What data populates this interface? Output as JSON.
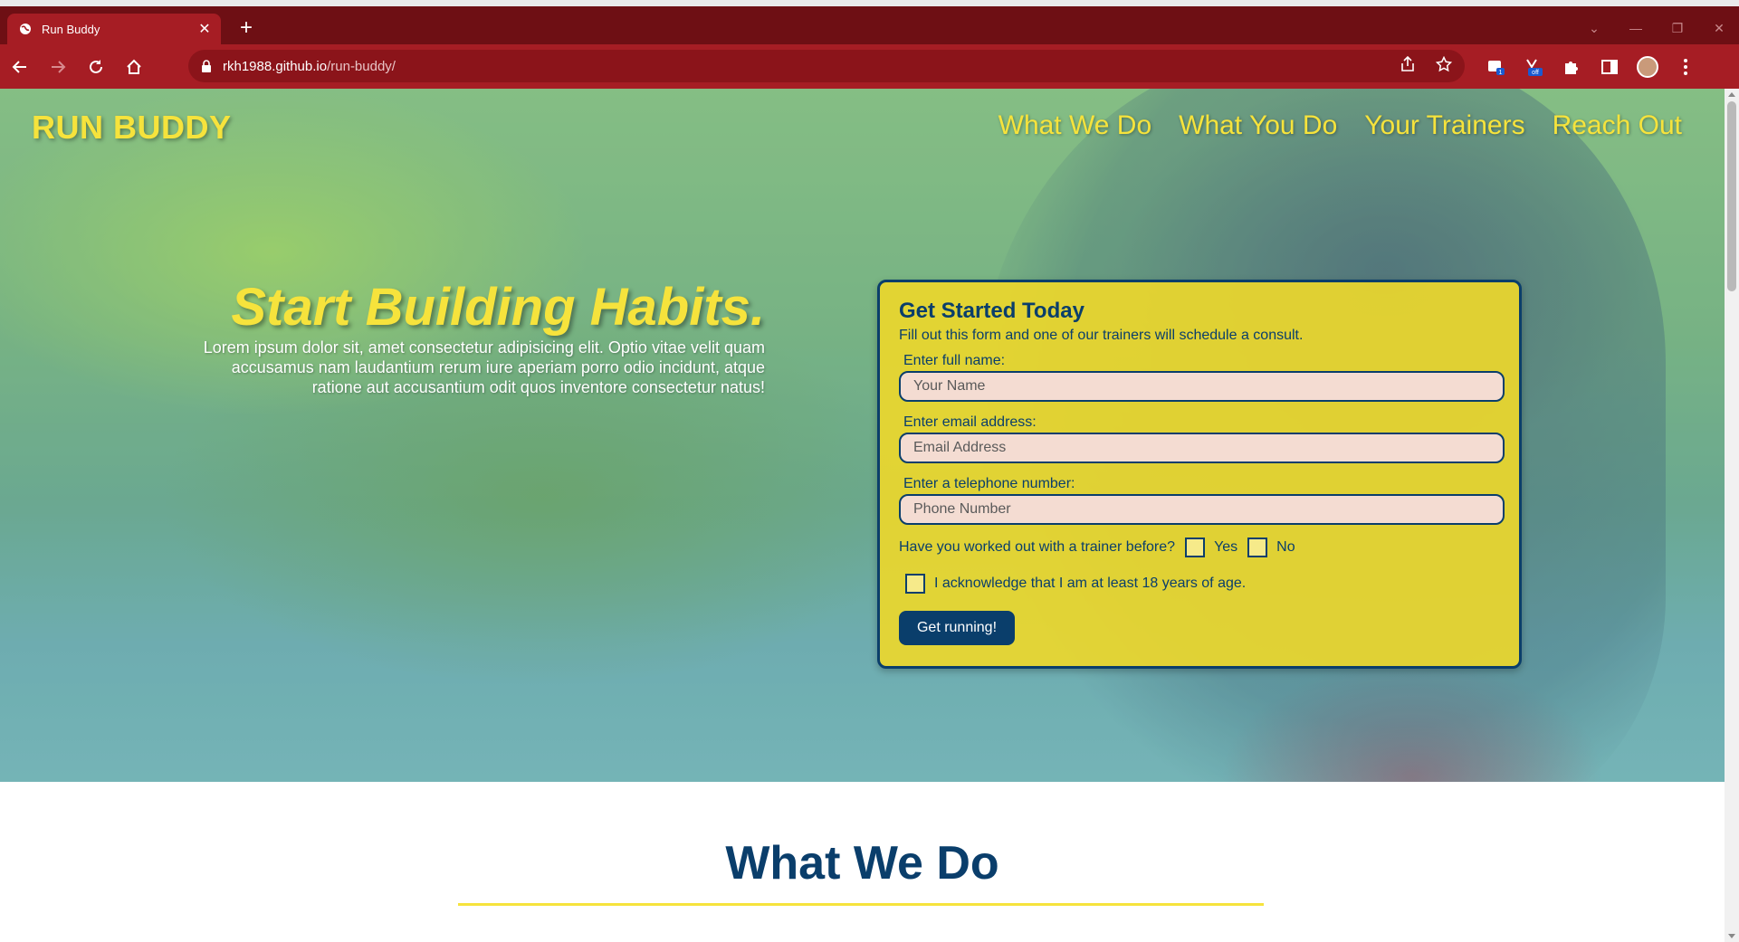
{
  "browser": {
    "tab_title": "Run Buddy",
    "tab_close_glyph": "✕",
    "new_tab_glyph": "+",
    "url_host": "rkh1988.github.io",
    "url_path": "/run-buddy/",
    "icons": [
      "back-icon",
      "forward-icon",
      "reload-icon",
      "home-icon",
      "lock-icon",
      "share-icon",
      "star-icon",
      "extension-icon",
      "puzzle-icon",
      "sidepanel-icon",
      "profile-avatar",
      "menu-icon"
    ],
    "extension_badges": {
      "first": "1",
      "second": "off"
    }
  },
  "site": {
    "brand": "RUN BUDDY",
    "nav": [
      "What We Do",
      "What You Do",
      "Your Trainers",
      "Reach Out"
    ],
    "hero": {
      "title": "Start Building Habits.",
      "text": "Lorem ipsum dolor sit, amet consectetur adipisicing elit. Optio vitae velit quam accusamus nam laudantium rerum iure aperiam porro odio incidunt, atque ratione aut accusantium odit quos inventore consectetur natus!"
    },
    "form": {
      "title": "Get Started Today",
      "subtitle": "Fill out this form and one of our trainers will schedule a consult.",
      "name_label": "Enter full name:",
      "name_placeholder": "Your Name",
      "email_label": "Enter email address:",
      "email_placeholder": "Email Address",
      "phone_label": "Enter a telephone number:",
      "phone_placeholder": "Phone Number",
      "trainer_question": "Have you worked out with a trainer before?",
      "yes_label": "Yes",
      "no_label": "No",
      "ack_label": "I acknowledge that I am at least 18 years of age.",
      "submit_label": "Get running!"
    },
    "section_title": "What We Do"
  },
  "colors": {
    "brand_yellow": "#f6e33c",
    "navy": "#0a3e6b",
    "chrome_red": "#a61d24",
    "chrome_dark": "#6e0f14"
  }
}
